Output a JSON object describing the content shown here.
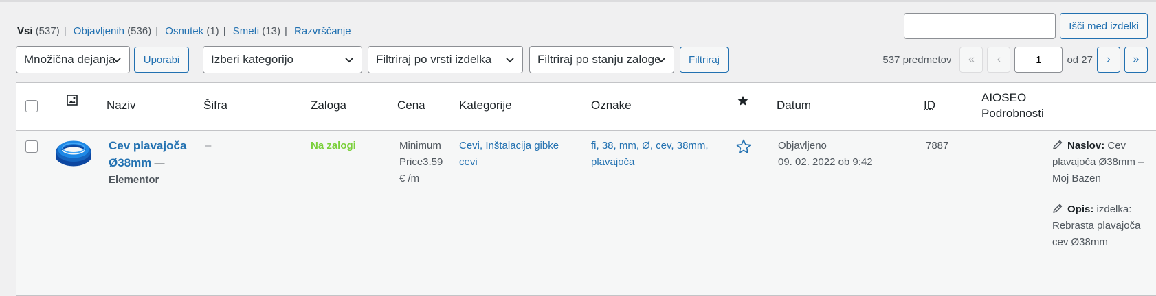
{
  "filters": [
    {
      "label": "Vsi",
      "count": "(537)",
      "current": true
    },
    {
      "label": "Objavljenih",
      "count": "(536)"
    },
    {
      "label": "Osnutek",
      "count": "(1)"
    },
    {
      "label": "Smeti",
      "count": "(13)"
    },
    {
      "label": "Razvrščanje",
      "count": ""
    }
  ],
  "search": {
    "value": "",
    "button": "Išči med izdelki"
  },
  "tablenav": {
    "bulk": "Množična dejanja",
    "apply": "Uporabi",
    "category": "Izberi kategorijo",
    "type": "Filtriraj po vrsti izdelka",
    "stock": "Filtriraj po stanju zaloge",
    "filter": "Filtriraj",
    "items": "537 predmetov",
    "first": "«",
    "prev": "‹",
    "page": "1",
    "of": "od 27",
    "next": "›",
    "last": "»"
  },
  "columns": {
    "name": "Naziv",
    "sku": "Šifra",
    "stock": "Zaloga",
    "price": "Cena",
    "categories": "Kategorije",
    "tags": "Oznake",
    "date": "Datum",
    "id": "ID",
    "aioseo": "AIOSEO Podrobnosti"
  },
  "row": {
    "title": "Cev plavajoča Ø38mm",
    "dash": " —",
    "builder": "Elementor",
    "sku": "–",
    "stock": "Na zalogi",
    "price_line1": "Minimum",
    "price_line2": "Price3.59",
    "price_line3": "€ /m",
    "cat_line1": "Cevi, Inštalacija gibke",
    "cat_line2": "cevi",
    "tags_line1": "fi, 38, mm, Ø, cev, 38mm,",
    "tags_line2": "plavajoča",
    "date_status": "Objavljeno",
    "date_value": "09. 02. 2022 ob 9:42",
    "id": "7887",
    "aio_title_label": "Naslov:",
    "aio_title_value": "Cev plavajoča Ø38mm – Moj Bazen",
    "aio_desc_label": "Opis:",
    "aio_desc_value": "izdelka: Rebrasta plavajoča cev Ø38mm"
  },
  "colors": {
    "link": "#2271b1",
    "instock": "#7ad03a",
    "product_blue": "#1565c0"
  }
}
